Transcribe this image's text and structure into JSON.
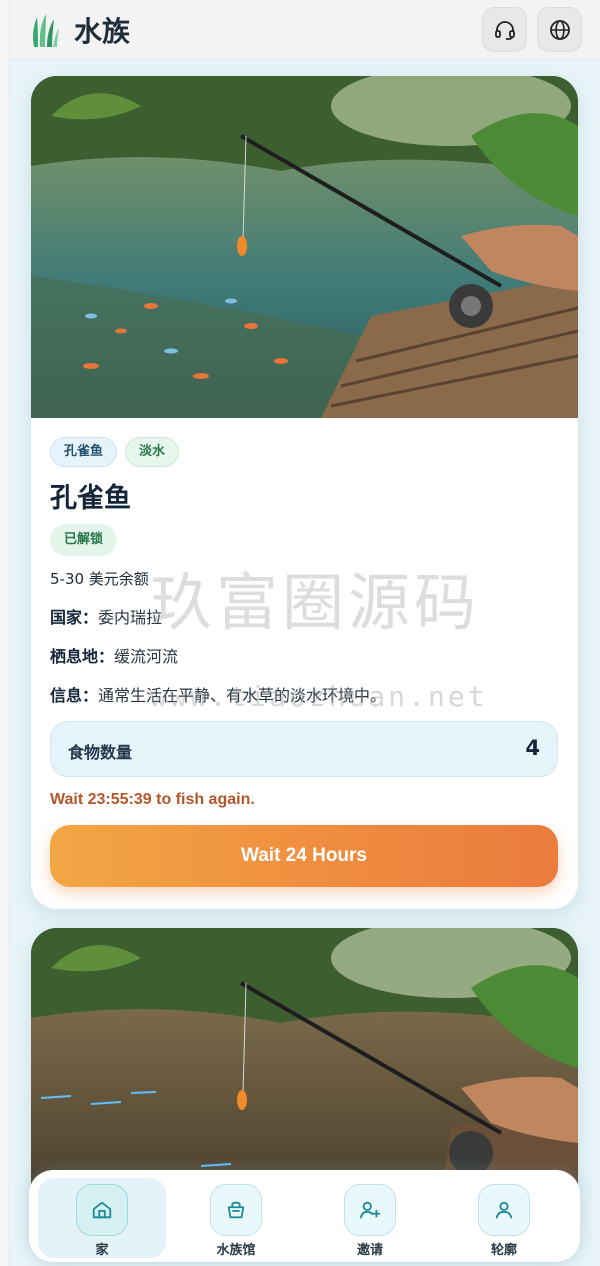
{
  "header": {
    "title": "水族"
  },
  "card": {
    "tags": [
      "孔雀鱼",
      "淡水"
    ],
    "name": "孔雀鱼",
    "status": "已解锁",
    "reward": "5-30 美元余额",
    "country_label": "国家：",
    "country": "委内瑞拉",
    "habitat_label": "栖息地：",
    "habitat": "缓流河流",
    "info_label": "信息：",
    "info": "通常生活在平静、有水草的淡水环境中。",
    "food_label": "食物数量",
    "food_value": "4",
    "wait_text": "Wait 23:55:39 to fish again.",
    "wait_button": "Wait 24 Hours"
  },
  "watermark": {
    "line1": "玖富圈源码",
    "line2": "www.tiaozhuan.net"
  },
  "nav": [
    {
      "label": "家",
      "icon": "home-icon",
      "active": true
    },
    {
      "label": "水族馆",
      "icon": "basket-icon",
      "active": false
    },
    {
      "label": "邀请",
      "icon": "add-user-icon",
      "active": false
    },
    {
      "label": "轮廓",
      "icon": "user-icon",
      "active": false
    }
  ],
  "colors": {
    "accent": "#ef8a3f",
    "wait_text": "#b5562a",
    "nav_active": "#e4f3f8",
    "teal_icon": "#1f8a9a"
  }
}
